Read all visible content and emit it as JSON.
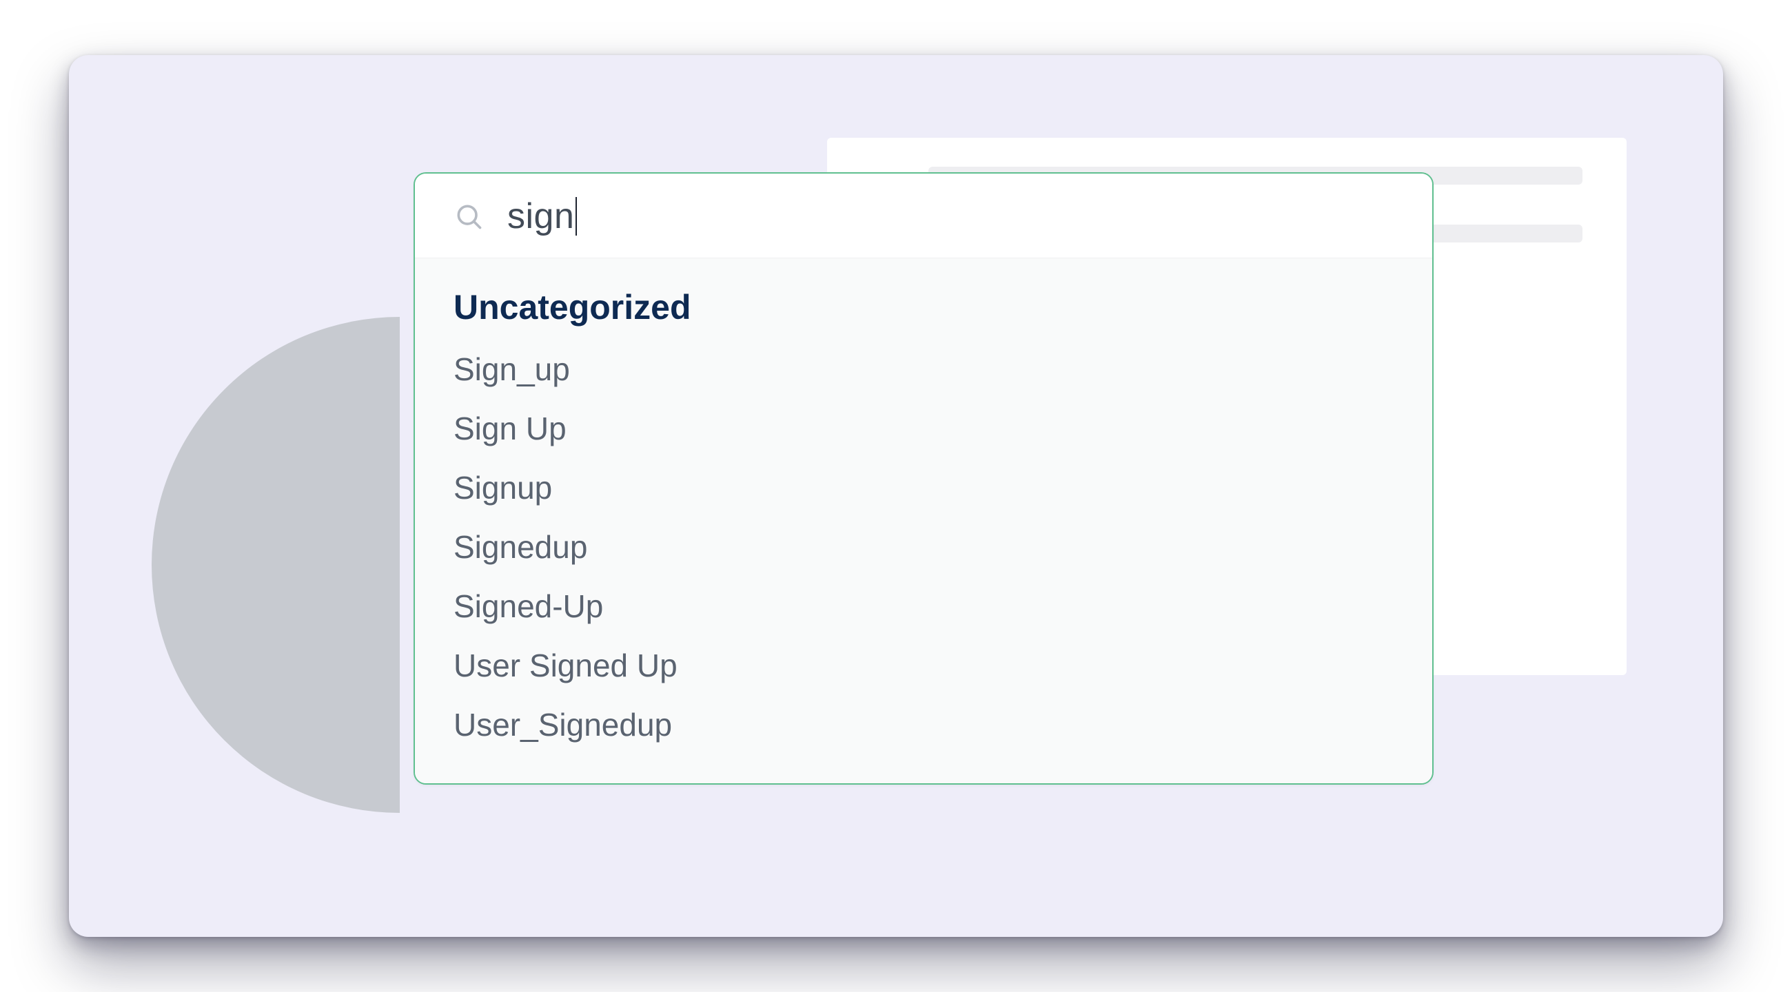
{
  "search": {
    "query": "sign",
    "placeholder": ""
  },
  "results": {
    "group_label": "Uncategorized",
    "items": [
      "Sign_up",
      "Sign Up",
      "Signup",
      "Signedup",
      "Signed-Up",
      "User Signed Up",
      "User_Signedup"
    ]
  },
  "colors": {
    "card_bg": "#EEEDF9",
    "panel_border": "#5FBF8F",
    "group_header": "#0E2A52",
    "item_text": "#5A6370"
  }
}
